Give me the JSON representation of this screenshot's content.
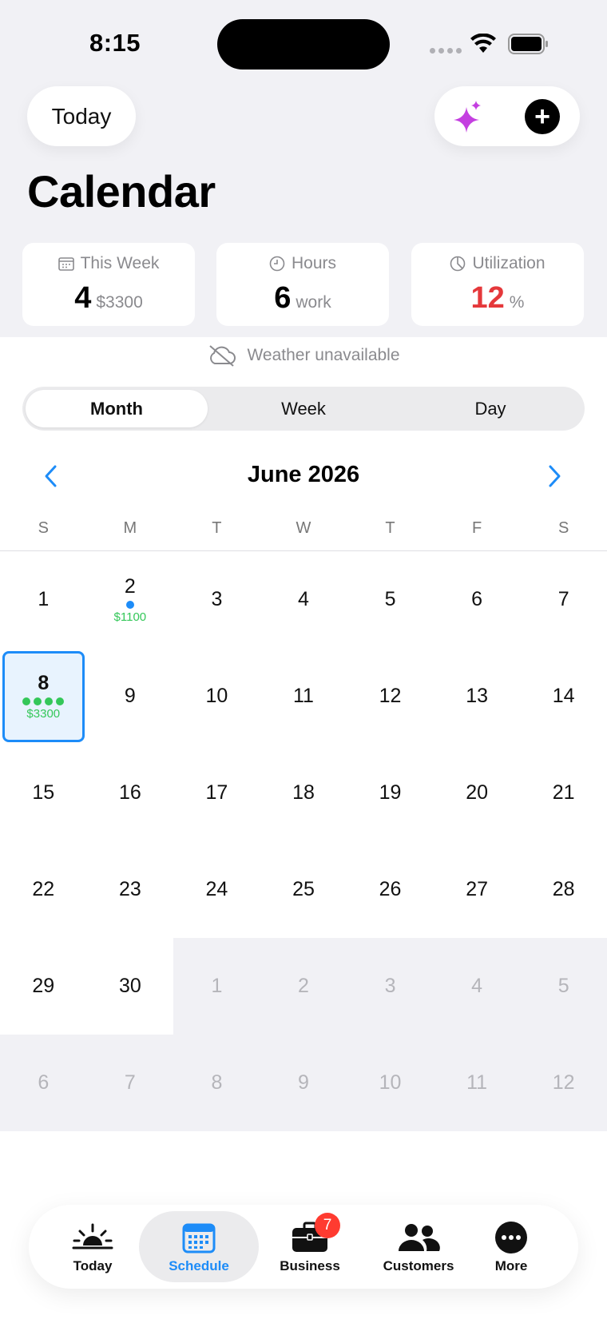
{
  "status_bar": {
    "time": "8:15"
  },
  "header": {
    "today_button": "Today",
    "add_symbol": "+",
    "title": "Calendar"
  },
  "stats": {
    "this_week": {
      "label": "This Week",
      "value": "4",
      "sub": "$3300",
      "icon": "calendar-icon"
    },
    "hours": {
      "label": "Hours",
      "value": "6",
      "sub": "work",
      "icon": "clock-icon"
    },
    "utilization": {
      "label": "Utilization",
      "value": "12",
      "sub": "%",
      "icon": "pie-icon",
      "color": "#e5383b"
    }
  },
  "weather": {
    "text": "Weather unavailable",
    "icon": "cloud-off-icon"
  },
  "view_tabs": {
    "month": "Month",
    "week": "Week",
    "day": "Day",
    "selected": "Month"
  },
  "calendar": {
    "title": "June 2026",
    "weekdays": [
      "S",
      "M",
      "T",
      "W",
      "T",
      "F",
      "S"
    ],
    "weeks": [
      [
        {
          "d": "1"
        },
        {
          "d": "2",
          "dots": [
            "#1d8cf8"
          ],
          "amount": "$1100"
        },
        {
          "d": "3"
        },
        {
          "d": "4"
        },
        {
          "d": "5"
        },
        {
          "d": "6"
        },
        {
          "d": "7"
        }
      ],
      [
        {
          "d": "8",
          "selected": true,
          "dots": [
            "#34c759",
            "#34c759",
            "#34c759",
            "#34c759"
          ],
          "amount": "$3300"
        },
        {
          "d": "9"
        },
        {
          "d": "10"
        },
        {
          "d": "11"
        },
        {
          "d": "12"
        },
        {
          "d": "13"
        },
        {
          "d": "14"
        }
      ],
      [
        {
          "d": "15"
        },
        {
          "d": "16"
        },
        {
          "d": "17"
        },
        {
          "d": "18"
        },
        {
          "d": "19"
        },
        {
          "d": "20"
        },
        {
          "d": "21"
        }
      ],
      [
        {
          "d": "22"
        },
        {
          "d": "23"
        },
        {
          "d": "24"
        },
        {
          "d": "25"
        },
        {
          "d": "26"
        },
        {
          "d": "27"
        },
        {
          "d": "28"
        }
      ],
      [
        {
          "d": "29"
        },
        {
          "d": "30"
        },
        {
          "d": "1",
          "out": true
        },
        {
          "d": "2",
          "out": true
        },
        {
          "d": "3",
          "out": true
        },
        {
          "d": "4",
          "out": true
        },
        {
          "d": "5",
          "out": true
        }
      ],
      [
        {
          "d": "6",
          "out": true
        },
        {
          "d": "7",
          "out": true
        },
        {
          "d": "8",
          "out": true
        },
        {
          "d": "9",
          "out": true
        },
        {
          "d": "10",
          "out": true
        },
        {
          "d": "11",
          "out": true
        },
        {
          "d": "12",
          "out": true
        }
      ]
    ]
  },
  "tabbar": {
    "today": "Today",
    "schedule": "Schedule",
    "business": "Business",
    "business_badge": "7",
    "customers": "Customers",
    "more": "More",
    "active": "Schedule",
    "accent": "#1d8cf8"
  }
}
